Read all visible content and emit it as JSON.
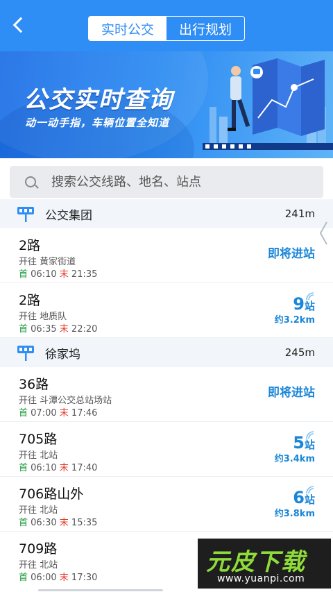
{
  "header": {
    "tabs": [
      {
        "label": "实时公交",
        "active": true
      },
      {
        "label": "出行规划",
        "active": false
      }
    ],
    "accent_color": "#2f8df6",
    "back_icon": "chevron-left-icon"
  },
  "banner": {
    "title": "公交实时查询",
    "subtitle": "动一动手指，车辆位置全知道"
  },
  "search": {
    "placeholder": "搜索公交线路、地名、站点",
    "value": ""
  },
  "stations": [
    {
      "name": "公交集团",
      "distance": "241m",
      "routes": [
        {
          "name": "2路",
          "dest": "开往 黄家街道",
          "first_label": "首",
          "first_time": "06:10",
          "last_label": "末",
          "last_time": "21:35",
          "status": "即将进站"
        },
        {
          "name": "2路",
          "dest": "开往 地质队",
          "first_label": "首",
          "first_time": "06:35",
          "last_label": "末",
          "last_time": "22:20",
          "stops": "9",
          "stops_unit": "站",
          "km": "约3.2km"
        }
      ]
    },
    {
      "name": "徐家坞",
      "distance": "245m",
      "routes": [
        {
          "name": "36路",
          "dest": "开往 斗潭公交总站场站",
          "first_label": "首",
          "first_time": "07:00",
          "last_label": "末",
          "last_time": "17:46",
          "status": "即将进站"
        },
        {
          "name": "705路",
          "dest": "开往 北站",
          "first_label": "首",
          "first_time": "06:10",
          "last_label": "末",
          "last_time": "17:40",
          "stops": "5",
          "stops_unit": "站",
          "km": "约3.4km"
        },
        {
          "name": "706路山外",
          "dest": "开往 北站",
          "first_label": "首",
          "first_time": "06:30",
          "last_label": "末",
          "last_time": "15:35",
          "stops": "6",
          "stops_unit": "站",
          "km": "约3.8km"
        },
        {
          "name": "709路",
          "dest": "开往 北站",
          "first_label": "首",
          "first_time": "06:00",
          "last_label": "末",
          "last_time": "17:30"
        }
      ]
    }
  ],
  "watermark": {
    "text": "元皮下载",
    "url": "www.yuanpi.com"
  }
}
